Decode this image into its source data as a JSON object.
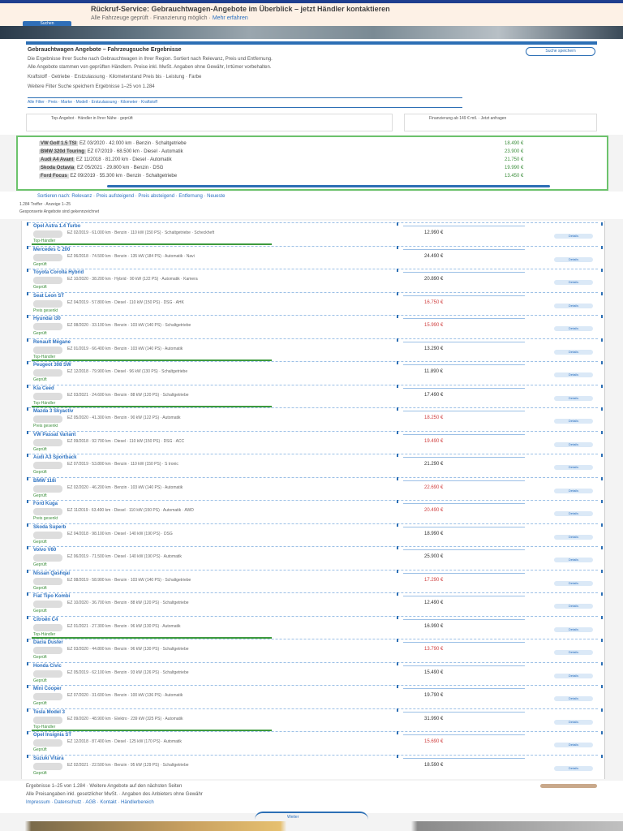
{
  "banner": {
    "title": "Rückruf-Service: Gebrauchtwagen-Angebote im Überblick – jetzt Händler kontaktieren",
    "subtitle": "Alle Fahrzeuge geprüft · Finanzierung möglich ·",
    "subtitle_link": "Mehr erfahren",
    "button": "Suchen"
  },
  "info": {
    "title": "Gebrauchtwagen Angebote – Fahrzeugsuche Ergebnisse",
    "lines": [
      "Die Ergebnisse Ihrer Suche nach Gebrauchtwagen in Ihrer Region. Sortiert nach Relevanz, Preis und Entfernung.",
      "Alle Angebote stammen von geprüften Händlern. Preise inkl. MwSt. Angaben ohne Gewähr, Irrtümer vorbehalten.",
      "Kraftstoff · Getriebe · Erstzulassung · Kilometerstand       Preis bis · Leistung · Farbe",
      "Weitere Filter          Suche speichern          Ergebnisse 1–25 von 1.284"
    ],
    "pill_button": "Suche speichern",
    "filters": "Alle Filter  ·  Preis  ·  Marke  ·  Modell  ·  Erstzulassung  ·  Kilometer  ·  Kraftstoff"
  },
  "cards": [
    {
      "label": "Top-Angebot · Händler in Ihrer Nähe · geprüft"
    },
    {
      "label": "Finanzierung ab 149 € mtl. · Jetzt anfragen"
    }
  ],
  "featured": {
    "rows": [
      {
        "name": "VW Golf 1.5 TSI",
        "text": "EZ 03/2020 · 42.000 km · Benzin · Schaltgetriebe",
        "price": "18.490 €"
      },
      {
        "name": "BMW 320d Touring",
        "text": "EZ 07/2019 · 68.500 km · Diesel · Automatik",
        "price": "23.900 €"
      },
      {
        "name": "Audi A4 Avant",
        "text": "EZ 11/2018 · 81.200 km · Diesel · Automatik",
        "price": "21.750 €"
      },
      {
        "name": "Skoda Octavia",
        "text": "EZ 05/2021 · 29.800 km · Benzin · DSG",
        "price": "19.990 €"
      },
      {
        "name": "Ford Focus",
        "text": "EZ 09/2019 · 55.300 km · Benzin · Schaltgetriebe",
        "price": "13.450 €"
      }
    ]
  },
  "sortbar": {
    "links": "Sortieren nach: Relevanz  ·  Preis aufsteigend  ·  Preis absteigend  ·  Entfernung  ·  Neueste",
    "line1": "1.284 Treffer · Anzeige 1–25",
    "line2": "Gesponserte Angebote sind gekennzeichnet"
  },
  "listings": [
    {
      "name": "Opel Astra 1.4 Turbo",
      "desc": "EZ 02/2019 · 61.000 km · Benzin · 110 kW (150 PS) · Schaltgetriebe · Scheckheft",
      "tag": "Top-Händler",
      "price": "12.990 €",
      "chip": "Details",
      "green": true,
      "red": false
    },
    {
      "name": "Mercedes C 200",
      "desc": "EZ 06/2018 · 74.500 km · Benzin · 135 kW (184 PS) · Automatik · Navi",
      "tag": "Geprüft",
      "price": "24.490 €",
      "chip": "Details",
      "green": false,
      "red": false
    },
    {
      "name": "Toyota Corolla Hybrid",
      "desc": "EZ 10/2020 · 38.200 km · Hybrid · 90 kW (122 PS) · Automatik · Kamera",
      "tag": "Geprüft",
      "price": "20.890 €",
      "chip": "Details",
      "green": false,
      "red": false
    },
    {
      "name": "Seat Leon ST",
      "desc": "EZ 04/2019 · 57.800 km · Diesel · 110 kW (150 PS) · DSG · AHK",
      "tag": "Preis gesenkt",
      "price": "16.750 €",
      "chip": "Details",
      "green": false,
      "red": true
    },
    {
      "name": "Hyundai i30",
      "desc": "EZ 08/2020 · 33.100 km · Benzin · 103 kW (140 PS) · Schaltgetriebe",
      "tag": "Geprüft",
      "price": "15.990 €",
      "chip": "Details",
      "green": false,
      "red": true
    },
    {
      "name": "Renault Mégane",
      "desc": "EZ 01/2019 · 66.400 km · Benzin · 103 kW (140 PS) · Automatik",
      "tag": "Top-Händler",
      "price": "13.290 €",
      "chip": "Details",
      "green": true,
      "red": false
    },
    {
      "name": "Peugeot 308 SW",
      "desc": "EZ 12/2018 · 79.900 km · Diesel · 96 kW (130 PS) · Schaltgetriebe",
      "tag": "Geprüft",
      "price": "11.890 €",
      "chip": "Details",
      "green": false,
      "red": false
    },
    {
      "name": "Kia Ceed",
      "desc": "EZ 03/2021 · 24.600 km · Benzin · 88 kW (120 PS) · Schaltgetriebe",
      "tag": "Top-Händler",
      "price": "17.490 €",
      "chip": "Details",
      "green": true,
      "red": false
    },
    {
      "name": "Mazda 3 Skyactiv",
      "desc": "EZ 05/2020 · 41.300 km · Benzin · 90 kW (122 PS) · Automatik",
      "tag": "Preis gesenkt",
      "price": "18.250 €",
      "chip": "Details",
      "green": false,
      "red": true
    },
    {
      "name": "VW Passat Variant",
      "desc": "EZ 09/2018 · 92.700 km · Diesel · 110 kW (150 PS) · DSG · ACC",
      "tag": "Geprüft",
      "price": "19.490 €",
      "chip": "Details",
      "green": false,
      "red": true
    },
    {
      "name": "Audi A3 Sportback",
      "desc": "EZ 07/2019 · 53.800 km · Benzin · 110 kW (150 PS) · S tronic",
      "tag": "Geprüft",
      "price": "21.290 €",
      "chip": "Details",
      "green": false,
      "red": false
    },
    {
      "name": "BMW 118i",
      "desc": "EZ 02/2020 · 46.200 km · Benzin · 103 kW (140 PS) · Automatik",
      "tag": "Geprüft",
      "price": "22.690 €",
      "chip": "Details",
      "green": false,
      "red": true
    },
    {
      "name": "Ford Kuga",
      "desc": "EZ 11/2019 · 63.400 km · Diesel · 110 kW (150 PS) · Automatik · AWD",
      "tag": "Preis gesenkt",
      "price": "20.490 €",
      "chip": "Details",
      "green": false,
      "red": true
    },
    {
      "name": "Skoda Superb",
      "desc": "EZ 04/2018 · 98.100 km · Diesel · 140 kW (190 PS) · DSG",
      "tag": "Geprüft",
      "price": "18.990 €",
      "chip": "Details",
      "green": false,
      "red": false
    },
    {
      "name": "Volvo V60",
      "desc": "EZ 06/2019 · 71.500 km · Diesel · 140 kW (190 PS) · Automatik",
      "tag": "Geprüft",
      "price": "25.900 €",
      "chip": "Details",
      "green": false,
      "red": false
    },
    {
      "name": "Nissan Qashqai",
      "desc": "EZ 08/2019 · 58.900 km · Benzin · 103 kW (140 PS) · Schaltgetriebe",
      "tag": "Geprüft",
      "price": "17.290 €",
      "chip": "Details",
      "green": false,
      "red": true
    },
    {
      "name": "Fiat Tipo Kombi",
      "desc": "EZ 10/2020 · 36.700 km · Benzin · 88 kW (120 PS) · Schaltgetriebe",
      "tag": "Geprüft",
      "price": "12.490 €",
      "chip": "Details",
      "green": false,
      "red": false
    },
    {
      "name": "Citroën C4",
      "desc": "EZ 01/2021 · 27.300 km · Benzin · 96 kW (130 PS) · Automatik",
      "tag": "Top-Händler",
      "price": "16.990 €",
      "chip": "Details",
      "green": true,
      "red": false
    },
    {
      "name": "Dacia Duster",
      "desc": "EZ 03/2020 · 44.800 km · Benzin · 96 kW (130 PS) · Schaltgetriebe",
      "tag": "Geprüft",
      "price": "13.790 €",
      "chip": "Details",
      "green": false,
      "red": true
    },
    {
      "name": "Honda Civic",
      "desc": "EZ 05/2019 · 62.100 km · Benzin · 93 kW (126 PS) · Schaltgetriebe",
      "tag": "Geprüft",
      "price": "15.490 €",
      "chip": "Details",
      "green": false,
      "red": false
    },
    {
      "name": "Mini Cooper",
      "desc": "EZ 07/2020 · 31.600 km · Benzin · 100 kW (136 PS) · Automatik",
      "tag": "Geprüft",
      "price": "19.790 €",
      "chip": "Details",
      "green": false,
      "red": false
    },
    {
      "name": "Tesla Model 3",
      "desc": "EZ 09/2020 · 48.900 km · Elektro · 239 kW (325 PS) · Automatik",
      "tag": "Top-Händler",
      "price": "31.990 €",
      "chip": "Details",
      "green": true,
      "red": false
    },
    {
      "name": "Opel Insignia ST",
      "desc": "EZ 12/2018 · 87.400 km · Diesel · 125 kW (170 PS) · Automatik",
      "tag": "Geprüft",
      "price": "15.690 €",
      "chip": "Details",
      "green": false,
      "red": true
    },
    {
      "name": "Suzuki Vitara",
      "desc": "EZ 02/2021 · 22.500 km · Benzin · 95 kW (129 PS) · Schaltgetriebe",
      "tag": "Geprüft",
      "price": "18.590 €",
      "chip": "Details",
      "green": false,
      "red": false
    }
  ],
  "footer": {
    "line1": "Ergebnisse 1–25 von 1.284 · Weitere Angebote auf den nächsten Seiten",
    "line2": "Alle Preisangaben inkl. gesetzlicher MwSt. · Angaben des Anbieters ohne Gewähr",
    "line3": "Impressum · Datenschutz · AGB · Kontakt · Händlerbereich",
    "next": "Weiter"
  }
}
